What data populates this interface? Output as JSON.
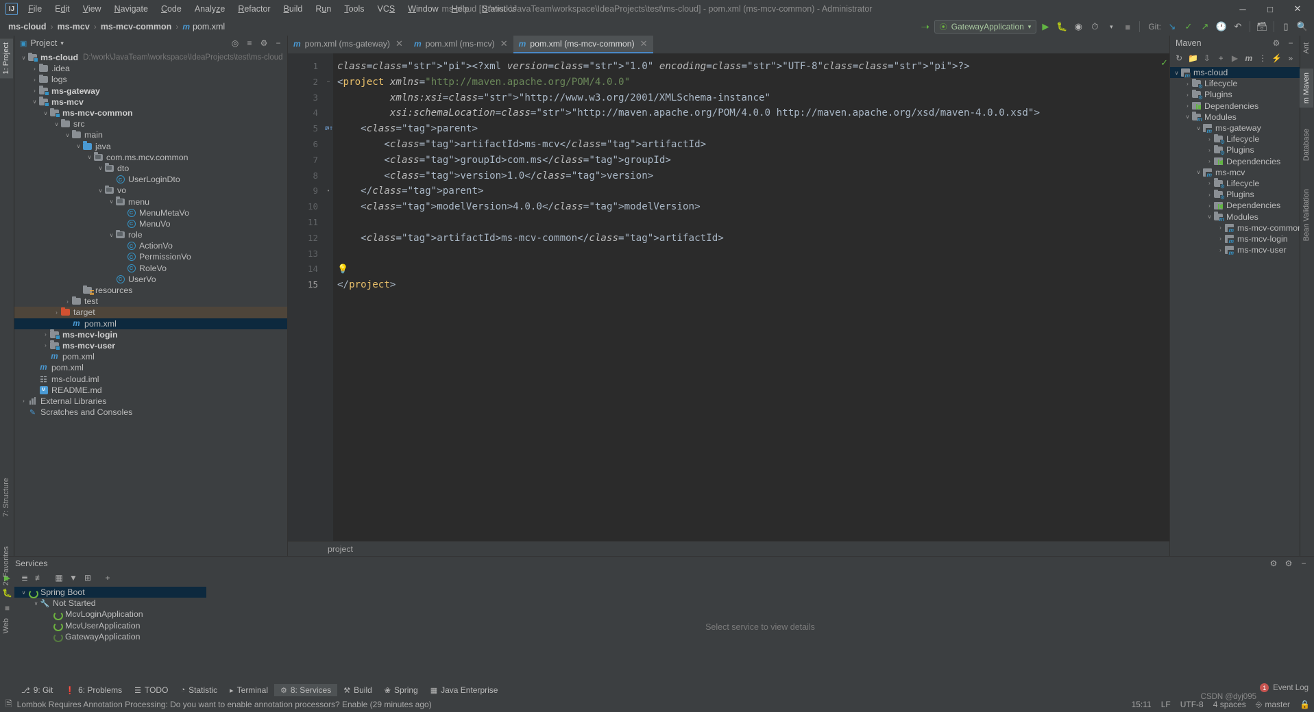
{
  "window": {
    "title": "ms-cloud [D:\\work\\JavaTeam\\workspace\\IdeaProjects\\test\\ms-cloud] - pom.xml (ms-mcv-common) - Administrator",
    "minimize": "─",
    "maximize": "□",
    "close": "✕",
    "logo": "IJ"
  },
  "menu": {
    "items": [
      "File",
      "Edit",
      "View",
      "Navigate",
      "Code",
      "Analyze",
      "Refactor",
      "Build",
      "Run",
      "Tools",
      "VCS",
      "Window",
      "Help",
      "Statistics"
    ]
  },
  "navbar": {
    "breadcrumbs": [
      "ms-cloud",
      "ms-mcv",
      "ms-mcv-common",
      "pom.xml"
    ],
    "separator": "›",
    "run_config": "GatewayApplication",
    "git_label": "Git:",
    "icons": {
      "build": "build-hammer-icon",
      "run": "run-icon",
      "debug": "debug-icon",
      "run_coverage": "run-with-coverage-icon",
      "profiler": "profiler-icon",
      "stop": "stop-icon",
      "update": "git-update-icon",
      "commit": "git-commit-icon",
      "push": "git-push-icon",
      "history": "git-history-icon",
      "rollback": "git-rollback-icon",
      "struct": "project-structure-icon",
      "terminal": "terminal-icon",
      "search": "search-everywhere-icon"
    }
  },
  "left_rails": [
    {
      "label": "1: Project",
      "selected": true
    },
    {
      "label": "7: Structure",
      "selected": false
    },
    {
      "label": "2: Favorites",
      "selected": false
    },
    {
      "label": "Web",
      "selected": false
    }
  ],
  "right_rails": [
    {
      "label": "Ant",
      "selected": false
    },
    {
      "label": "m Maven",
      "selected": true
    },
    {
      "label": "Database",
      "selected": false
    },
    {
      "label": "Bean Validation",
      "selected": false
    }
  ],
  "project_panel": {
    "title": "Project",
    "chevron": "▾",
    "actions": [
      "locate-icon",
      "collapse-all-icon",
      "settings-icon",
      "hide-icon"
    ],
    "tree": [
      {
        "depth": 0,
        "arrow": "∨",
        "icon": "module-folder",
        "label": "ms-cloud",
        "bold": true,
        "suffix": "D:\\work\\JavaTeam\\workspace\\IdeaProjects\\test\\ms-cloud"
      },
      {
        "depth": 1,
        "arrow": "›",
        "icon": "folder",
        "label": ".idea"
      },
      {
        "depth": 1,
        "arrow": "›",
        "icon": "folder",
        "label": "logs"
      },
      {
        "depth": 1,
        "arrow": "›",
        "icon": "module-folder",
        "label": "ms-gateway",
        "bold": true
      },
      {
        "depth": 1,
        "arrow": "∨",
        "icon": "module-folder",
        "label": "ms-mcv",
        "bold": true
      },
      {
        "depth": 2,
        "arrow": "∨",
        "icon": "module-folder",
        "label": "ms-mcv-common",
        "bold": true
      },
      {
        "depth": 3,
        "arrow": "∨",
        "icon": "folder",
        "label": "src"
      },
      {
        "depth": 4,
        "arrow": "∨",
        "icon": "folder",
        "label": "main"
      },
      {
        "depth": 5,
        "arrow": "∨",
        "icon": "source-folder",
        "label": "java"
      },
      {
        "depth": 6,
        "arrow": "∨",
        "icon": "package",
        "label": "com.ms.mcv.common"
      },
      {
        "depth": 7,
        "arrow": "∨",
        "icon": "package",
        "label": "dto"
      },
      {
        "depth": 8,
        "arrow": "",
        "icon": "class",
        "label": "UserLoginDto"
      },
      {
        "depth": 7,
        "arrow": "∨",
        "icon": "package",
        "label": "vo"
      },
      {
        "depth": 8,
        "arrow": "∨",
        "icon": "package",
        "label": "menu"
      },
      {
        "depth": 9,
        "arrow": "",
        "icon": "class",
        "label": "MenuMetaVo"
      },
      {
        "depth": 9,
        "arrow": "",
        "icon": "class",
        "label": "MenuVo"
      },
      {
        "depth": 8,
        "arrow": "∨",
        "icon": "package",
        "label": "role"
      },
      {
        "depth": 9,
        "arrow": "",
        "icon": "class",
        "label": "ActionVo"
      },
      {
        "depth": 9,
        "arrow": "",
        "icon": "class",
        "label": "PermissionVo"
      },
      {
        "depth": 9,
        "arrow": "",
        "icon": "class",
        "label": "RoleVo"
      },
      {
        "depth": 8,
        "arrow": "",
        "icon": "class",
        "label": "UserVo"
      },
      {
        "depth": 5,
        "arrow": "",
        "icon": "resource-folder",
        "label": "resources"
      },
      {
        "depth": 4,
        "arrow": "›",
        "icon": "folder",
        "label": "test"
      },
      {
        "depth": 3,
        "arrow": "›",
        "icon": "excluded-folder",
        "label": "target",
        "state": "hover"
      },
      {
        "depth": 4,
        "arrow": "",
        "icon": "maven-file",
        "label": "pom.xml",
        "state": "selected"
      },
      {
        "depth": 2,
        "arrow": "›",
        "icon": "module-folder",
        "label": "ms-mcv-login",
        "bold": true
      },
      {
        "depth": 2,
        "arrow": "›",
        "icon": "module-folder",
        "label": "ms-mcv-user",
        "bold": true
      },
      {
        "depth": 2,
        "arrow": "",
        "icon": "maven-file",
        "label": "pom.xml"
      },
      {
        "depth": 1,
        "arrow": "",
        "icon": "maven-file",
        "label": "pom.xml"
      },
      {
        "depth": 1,
        "arrow": "",
        "icon": "iml-file",
        "label": "ms-cloud.iml"
      },
      {
        "depth": 1,
        "arrow": "",
        "icon": "markdown-file",
        "label": "README.md"
      },
      {
        "depth": 0,
        "arrow": "›",
        "icon": "library",
        "label": "External Libraries"
      },
      {
        "depth": 0,
        "arrow": "",
        "icon": "scratches",
        "label": "Scratches and Consoles"
      }
    ]
  },
  "editor": {
    "tabs": [
      {
        "label": "pom.xml (ms-gateway)",
        "icon": "maven-file",
        "active": false
      },
      {
        "label": "pom.xml (ms-mcv)",
        "icon": "maven-file",
        "active": false
      },
      {
        "label": "pom.xml (ms-mcv-common)",
        "icon": "maven-file",
        "active": true
      }
    ],
    "inspection_status": "✓",
    "line_numbers": [
      "1",
      "2",
      "3",
      "4",
      "5",
      "6",
      "7",
      "8",
      "9",
      "10",
      "11",
      "12",
      "13",
      "14",
      "15"
    ],
    "current_line": 15,
    "line5_marker": "m↑",
    "bulb_line": 14,
    "lines": [
      "<?xml version=\"1.0\" encoding=\"UTF-8\"?>",
      "<project xmlns=\"http://maven.apache.org/POM/4.0.0\"",
      "         xmlns:xsi=\"http://www.w3.org/2001/XMLSchema-instance\"",
      "         xsi:schemaLocation=\"http://maven.apache.org/POM/4.0.0 http://maven.apache.org/xsd/maven-4.0.0.xsd\">",
      "    <parent>",
      "        <artifactId>ms-mcv</artifactId>",
      "        <groupId>com.ms</groupId>",
      "        <version>1.0</version>",
      "    </parent>",
      "    <modelVersion>4.0.0</modelVersion>",
      "",
      "    <artifactId>ms-mcv-common</artifactId>",
      "",
      "",
      "</project>"
    ],
    "breadcrumb": "project"
  },
  "maven_panel": {
    "title": "Maven",
    "toolbar": [
      "reload-icon",
      "add-maven-project-icon",
      "download-sources-icon",
      "add-icon",
      "run-icon",
      "execute-goal-icon",
      "toggle-skip-tests-icon",
      "toggle-offline-icon",
      "more-icon"
    ],
    "settings_icon": "gear-icon",
    "hide_icon": "hide-icon",
    "tree": [
      {
        "depth": 0,
        "arrow": "∨",
        "icon": "maven-project",
        "label": "ms-cloud",
        "state": "selected"
      },
      {
        "depth": 1,
        "arrow": "›",
        "icon": "lifecycle",
        "label": "Lifecycle"
      },
      {
        "depth": 1,
        "arrow": "›",
        "icon": "plugins",
        "label": "Plugins"
      },
      {
        "depth": 1,
        "arrow": "›",
        "icon": "dependencies",
        "label": "Dependencies"
      },
      {
        "depth": 1,
        "arrow": "∨",
        "icon": "modules",
        "label": "Modules"
      },
      {
        "depth": 2,
        "arrow": "∨",
        "icon": "maven-project",
        "label": "ms-gateway"
      },
      {
        "depth": 3,
        "arrow": "›",
        "icon": "lifecycle",
        "label": "Lifecycle"
      },
      {
        "depth": 3,
        "arrow": "›",
        "icon": "plugins",
        "label": "Plugins"
      },
      {
        "depth": 3,
        "arrow": "›",
        "icon": "dependencies",
        "label": "Dependencies"
      },
      {
        "depth": 2,
        "arrow": "∨",
        "icon": "maven-project",
        "label": "ms-mcv"
      },
      {
        "depth": 3,
        "arrow": "›",
        "icon": "lifecycle",
        "label": "Lifecycle"
      },
      {
        "depth": 3,
        "arrow": "›",
        "icon": "plugins",
        "label": "Plugins"
      },
      {
        "depth": 3,
        "arrow": "›",
        "icon": "dependencies",
        "label": "Dependencies"
      },
      {
        "depth": 3,
        "arrow": "∨",
        "icon": "modules",
        "label": "Modules"
      },
      {
        "depth": 4,
        "arrow": "›",
        "icon": "maven-project",
        "label": "ms-mcv-common"
      },
      {
        "depth": 4,
        "arrow": "›",
        "icon": "maven-project",
        "label": "ms-mcv-login"
      },
      {
        "depth": 4,
        "arrow": "›",
        "icon": "maven-project",
        "label": "ms-mcv-user"
      }
    ]
  },
  "services": {
    "title": "Services",
    "header_actions": [
      "settings-gear-icon",
      "help-icon",
      "hide-icon"
    ],
    "rail_icons": [
      "run-icon",
      "debug-icon",
      "stop-icon"
    ],
    "toolbar": [
      "expand-all-icon",
      "collapse-all-icon",
      "group-icon",
      "filter-icon",
      "add-tab-icon",
      "add-service-icon"
    ],
    "tree": [
      {
        "depth": 0,
        "arrow": "∨",
        "icon": "spring-boot",
        "label": "Spring Boot",
        "state": "selected"
      },
      {
        "depth": 1,
        "arrow": "∨",
        "icon": "wrench",
        "label": "Not Started"
      },
      {
        "depth": 2,
        "arrow": "",
        "icon": "spring-boot",
        "label": "McvLoginApplication"
      },
      {
        "depth": 2,
        "arrow": "",
        "icon": "spring-boot",
        "label": "McvUserApplication"
      },
      {
        "depth": 2,
        "arrow": "",
        "icon": "spring-boot-dim",
        "label": "GatewayApplication"
      }
    ],
    "empty_detail": "Select service to view details"
  },
  "toolstrip": {
    "items": [
      {
        "label": "9: Git",
        "icon": "git-icon",
        "selected": false
      },
      {
        "label": "6: Problems",
        "icon": "problems-icon",
        "selected": false
      },
      {
        "label": "TODO",
        "icon": "todo-icon",
        "selected": false
      },
      {
        "label": "Statistic",
        "icon": "statistic-icon",
        "selected": false
      },
      {
        "label": "Terminal",
        "icon": "terminal-icon",
        "selected": false
      },
      {
        "label": "8: Services",
        "icon": "services-icon",
        "selected": true
      },
      {
        "label": "Build",
        "icon": "build-icon",
        "selected": false
      },
      {
        "label": "Spring",
        "icon": "spring-icon",
        "selected": false
      },
      {
        "label": "Java Enterprise",
        "icon": "java-enterprise-icon",
        "selected": false
      }
    ]
  },
  "statusbar": {
    "message": "Lombok Requires Annotation Processing: Do you want to enable annotation processors? Enable (29 minutes ago)",
    "message_icon": "memo-icon",
    "caret": "15:11",
    "line_separator": "LF",
    "encoding": "UTF-8",
    "indent": "4 spaces",
    "branch": "master",
    "branch_icon": "git-branch-icon",
    "event_log": "Event Log",
    "event_count": "1",
    "watermark": "CSDN @dyj095",
    "lock_icon": "read-only-icon"
  },
  "colors": {
    "accent": "#3592c4",
    "selection": "#0d293e",
    "hover_row": "#4e453a",
    "green": "#62b543",
    "string": "#6a8759",
    "tag": "#e8bf6a",
    "panel": "#3c3f41",
    "editor_bg": "#2b2b2b",
    "highlight": "#32593d"
  }
}
